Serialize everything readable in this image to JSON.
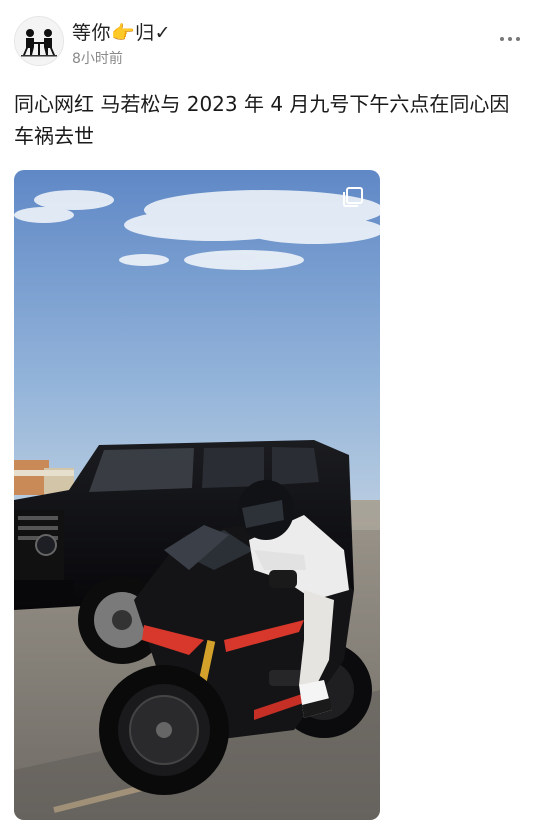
{
  "post": {
    "author": "等你👉归✓",
    "time": "8小时前",
    "text": "同心网红 马若松与 2023 年 4 月九号下午六点在同心因车祸去世"
  },
  "icons": {
    "more": "more-dots-icon",
    "multi_image": "multi-image-icon",
    "avatar_art": "two-people-table-silhouette"
  },
  "colors": {
    "sky_top": "#5d86c4",
    "sky_bottom": "#a7c3df",
    "road": "#7f7b74",
    "suv": "#0f0f12",
    "bike_accent": "#d8382b",
    "rider_suit": "#ececec"
  }
}
